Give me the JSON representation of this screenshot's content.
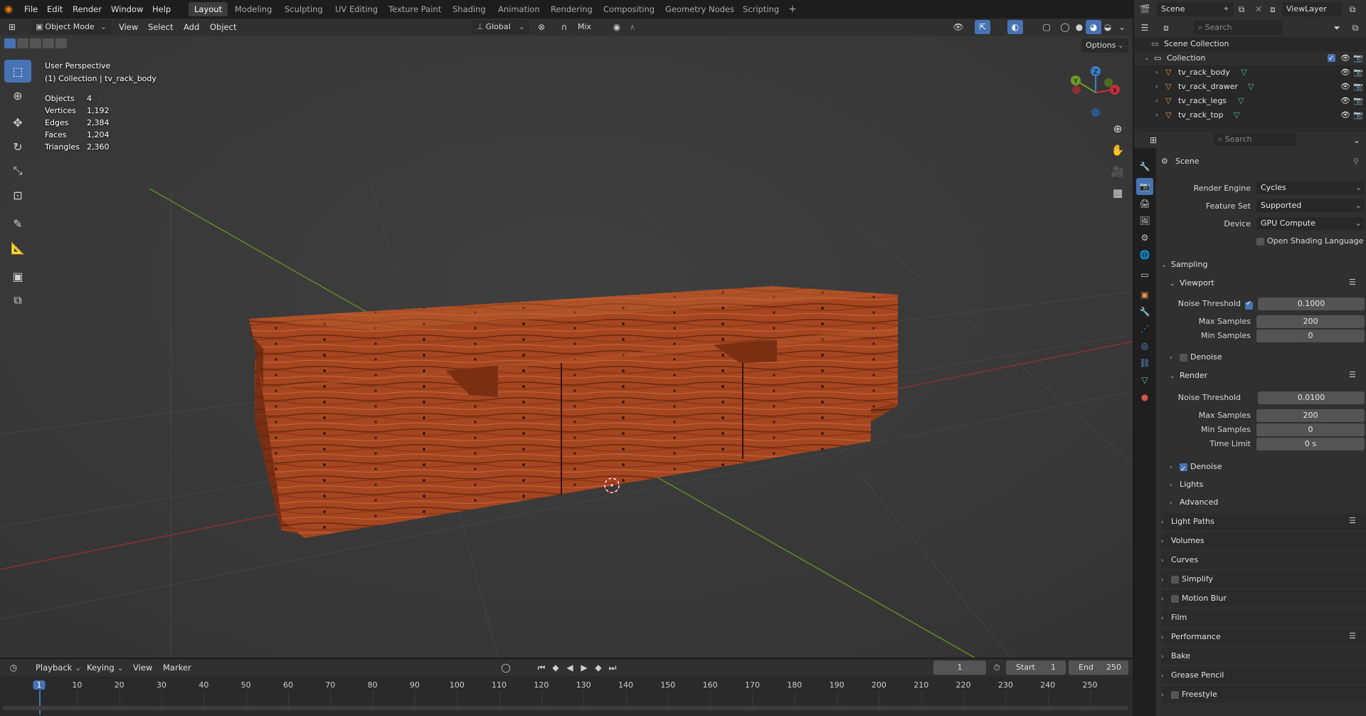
{
  "topbar": {
    "menus": [
      "File",
      "Edit",
      "Render",
      "Window",
      "Help"
    ],
    "workspaces": [
      "Layout",
      "Modeling",
      "Sculpting",
      "UV Editing",
      "Texture Paint",
      "Shading",
      "Animation",
      "Rendering",
      "Compositing",
      "Geometry Nodes",
      "Scripting"
    ],
    "active_workspace": "Layout",
    "scene_name": "Scene",
    "view_layer": "ViewLayer"
  },
  "viewport_header": {
    "mode": "Object Mode",
    "menus": [
      "View",
      "Select",
      "Add",
      "Object"
    ],
    "transform_orientation": "Global",
    "snap_mode": "Mix",
    "options_label": "Options"
  },
  "viewport_overlay": {
    "perspective": "User Perspective",
    "collection_line": "(1) Collection | tv_rack_body",
    "stats": [
      {
        "label": "Objects",
        "value": "4"
      },
      {
        "label": "Vertices",
        "value": "1,192"
      },
      {
        "label": "Edges",
        "value": "2,384"
      },
      {
        "label": "Faces",
        "value": "1,204"
      },
      {
        "label": "Triangles",
        "value": "2,360"
      }
    ],
    "gizmo_axes": [
      "X",
      "Y",
      "Z"
    ]
  },
  "outliner": {
    "search_placeholder": "Search",
    "scene_collection": "Scene Collection",
    "collection": "Collection",
    "objects": [
      "tv_rack_body",
      "tv_rack_drawer",
      "tv_rack_legs",
      "tv_rack_top"
    ]
  },
  "properties": {
    "search_placeholder": "Search",
    "context": "Scene",
    "render_engine_label": "Render Engine",
    "render_engine": "Cycles",
    "feature_set_label": "Feature Set",
    "feature_set": "Supported",
    "device_label": "Device",
    "device": "GPU Compute",
    "osl_label": "Open Shading Language",
    "sampling": "Sampling",
    "viewport": "Viewport",
    "render": "Render",
    "noise_threshold_label": "Noise Threshold",
    "max_samples_label": "Max Samples",
    "min_samples_label": "Min Samples",
    "time_limit_label": "Time Limit",
    "viewport_noise_threshold": "0.1000",
    "viewport_max_samples": "200",
    "viewport_min_samples": "0",
    "render_noise_threshold": "0.0100",
    "render_max_samples": "200",
    "render_min_samples": "0",
    "render_time_limit": "0 s",
    "denoise_label": "Denoise",
    "lights_label": "Lights",
    "advanced_label": "Advanced",
    "panels": [
      "Light Paths",
      "Volumes",
      "Curves",
      "Simplify",
      "Motion Blur",
      "Film",
      "Performance",
      "Bake",
      "Grease Pencil",
      "Freestyle"
    ]
  },
  "timeline": {
    "menus": [
      "Playback",
      "Keying",
      "View",
      "Marker"
    ],
    "current_frame": "1",
    "start_label": "Start",
    "start": "1",
    "end_label": "End",
    "end": "250",
    "ticks": [
      "1",
      "10",
      "20",
      "30",
      "40",
      "50",
      "60",
      "70",
      "80",
      "90",
      "100",
      "110",
      "120",
      "130",
      "140",
      "150",
      "160",
      "170",
      "180",
      "190",
      "200",
      "210",
      "220",
      "230",
      "240",
      "250"
    ]
  },
  "colors": {
    "accent": "#4772b3",
    "x_axis": "#c6303e",
    "y_axis": "#6b9a2a",
    "z_axis": "#3d7cc9",
    "wood": "#a4441f"
  }
}
